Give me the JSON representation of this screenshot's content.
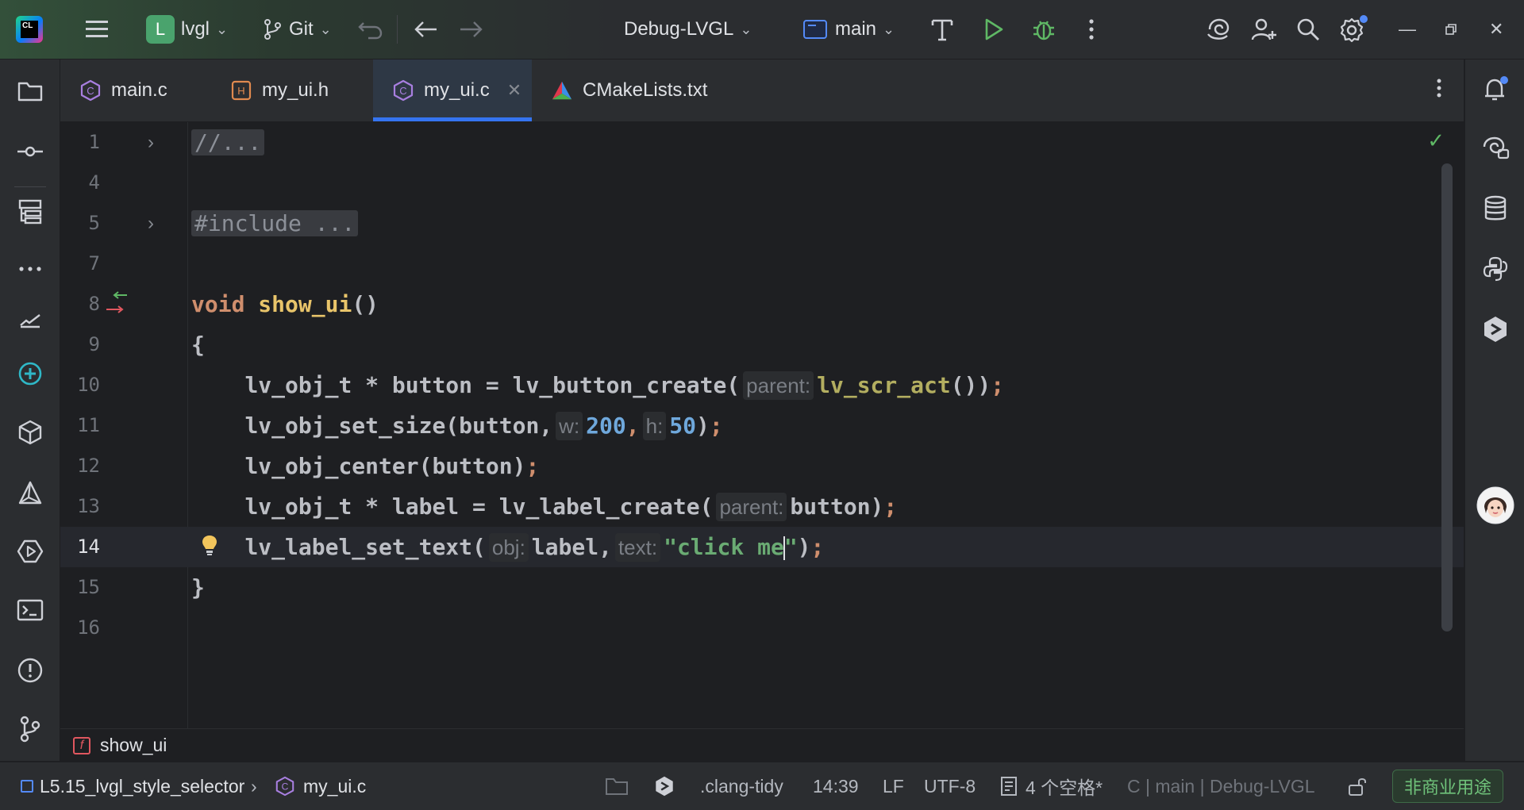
{
  "titlebar": {
    "project_initial": "L",
    "project_name": "lvgl",
    "vcs_label": "Git",
    "run_config": "Debug-LVGL",
    "branch": "main"
  },
  "tabs": [
    {
      "label": "main.c",
      "icon": "c-file-icon"
    },
    {
      "label": "my_ui.h",
      "icon": "h-file-icon"
    },
    {
      "label": "my_ui.c",
      "icon": "c-file-icon",
      "active": true
    },
    {
      "label": "CMakeLists.txt",
      "icon": "cmake-icon"
    }
  ],
  "editor": {
    "line_numbers": [
      "1",
      "4",
      "5",
      "7",
      "8",
      "9",
      "10",
      "11",
      "12",
      "13",
      "14",
      "15",
      "16"
    ],
    "code": {
      "l1": "//...",
      "l5": "#include ...",
      "l8_kw": "void",
      "l8_fn": "show_ui",
      "l8_rest": "()",
      "l9": "{",
      "l10_a": "lv_obj_t * button = lv_button_create(",
      "l10_hint": "parent:",
      "l10_call": "lv_scr_act",
      "l10_b": "())",
      "l11_a": "lv_obj_set_size(button,",
      "l11_hint_w": "w:",
      "l11_w": "200",
      "l11_hint_h": "h:",
      "l11_h": "50",
      "l11_b": ")",
      "l12_a": "lv_obj_center(button)",
      "l13_a": "lv_obj_t * label = lv_label_create(",
      "l13_hint": "parent:",
      "l13_b": "button)",
      "l14_a": "lv_label_set_text(",
      "l14_hint_obj": "obj:",
      "l14_b": "label,",
      "l14_hint_text": "text:",
      "l14_str1": "\"click me",
      "l14_str2": "\"",
      "l14_c": ")",
      "semicolon": ";",
      "comma": ",",
      "l15": "}"
    }
  },
  "breadcrumb": {
    "function_badge": "f",
    "function_name": "show_ui"
  },
  "statusbar": {
    "project": "L5.15_lvgl_style_selector",
    "file": "my_ui.c",
    "linter": ".clang-tidy",
    "position": "14:39",
    "line_ending": "LF",
    "encoding": "UTF-8",
    "indent": "4 个空格*",
    "context": "C | main | Debug-LVGL",
    "license": "非商业用途"
  },
  "colors": {
    "accent": "#3574f0",
    "keyword": "#cf8e6d",
    "function": "#e8c46a",
    "number": "#6fa8dc",
    "string": "#6aab73"
  }
}
